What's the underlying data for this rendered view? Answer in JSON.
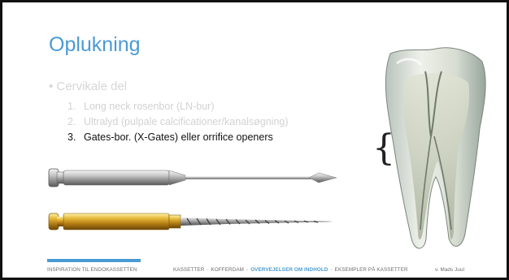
{
  "slide": {
    "title": "Oplukning",
    "bullet": "• Cervikale del",
    "items": [
      {
        "num": "1.",
        "text": "Long neck rosenbor (LN-bur)",
        "active": false
      },
      {
        "num": "2.",
        "text": "Ultralyd (pulpale calcificationer/kanalsøgning)",
        "active": false
      },
      {
        "num": "3.",
        "text": "Gates-bor. (X-Gates) eller orrifice openers",
        "active": true
      }
    ],
    "brace_glyph": "{"
  },
  "images": {
    "tool1": "gates-glidden-drill-icon",
    "tool2": "gold-rotary-file-icon",
    "tooth": "tooth-cross-section-icon"
  },
  "footer": {
    "left": "INSPIRATION TIL ENDOKASSETTEN",
    "nav": [
      "KASSETTER",
      "KOFFERDAM",
      "OVERVEJELSER OM INDHOLD",
      "EKSEMPLER PÅ KASSETTER"
    ],
    "separator": "-",
    "author": "v. Mads Juul"
  },
  "colors": {
    "accent": "#4a9bd2",
    "muted_text": "#d2d2d2",
    "active_text": "#111111"
  }
}
